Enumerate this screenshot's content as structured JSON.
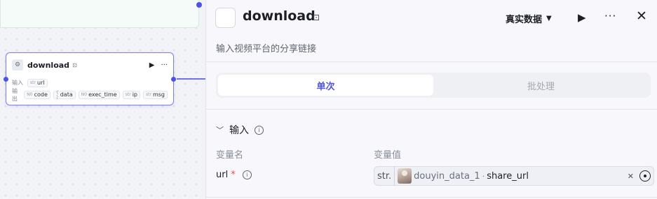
{
  "canvas": {
    "node": {
      "title": "download",
      "api_icon": "plugin-api-icon",
      "run_icon": "▶",
      "more_icon": "···",
      "input_label": "输入",
      "output_label": "输出",
      "inputs": [
        {
          "type": "str",
          "name": "url"
        }
      ],
      "outputs": [
        {
          "type": "N0",
          "name": "code"
        },
        {
          "type": "{ }",
          "name": "data"
        },
        {
          "type": "N0",
          "name": "exec_time"
        },
        {
          "type": "str",
          "name": "ip"
        },
        {
          "type": "str",
          "name": "msg"
        }
      ]
    }
  },
  "panel": {
    "title": "download",
    "description": "输入视频平台的分享链接",
    "data_mode": "真实数据",
    "tabs": [
      {
        "label": "单次",
        "active": true
      },
      {
        "label": "批处理",
        "active": false
      }
    ],
    "section_title": "输入",
    "column_name": "变量名",
    "column_value": "变量值",
    "param": {
      "name": "url",
      "required_mark": "*",
      "type_label": "str.",
      "ref_node": "douyin_data_1",
      "ref_sep": "·",
      "ref_field": "share_url"
    }
  },
  "colors": {
    "accent": "#4d53e8",
    "required": "#f54a45"
  }
}
